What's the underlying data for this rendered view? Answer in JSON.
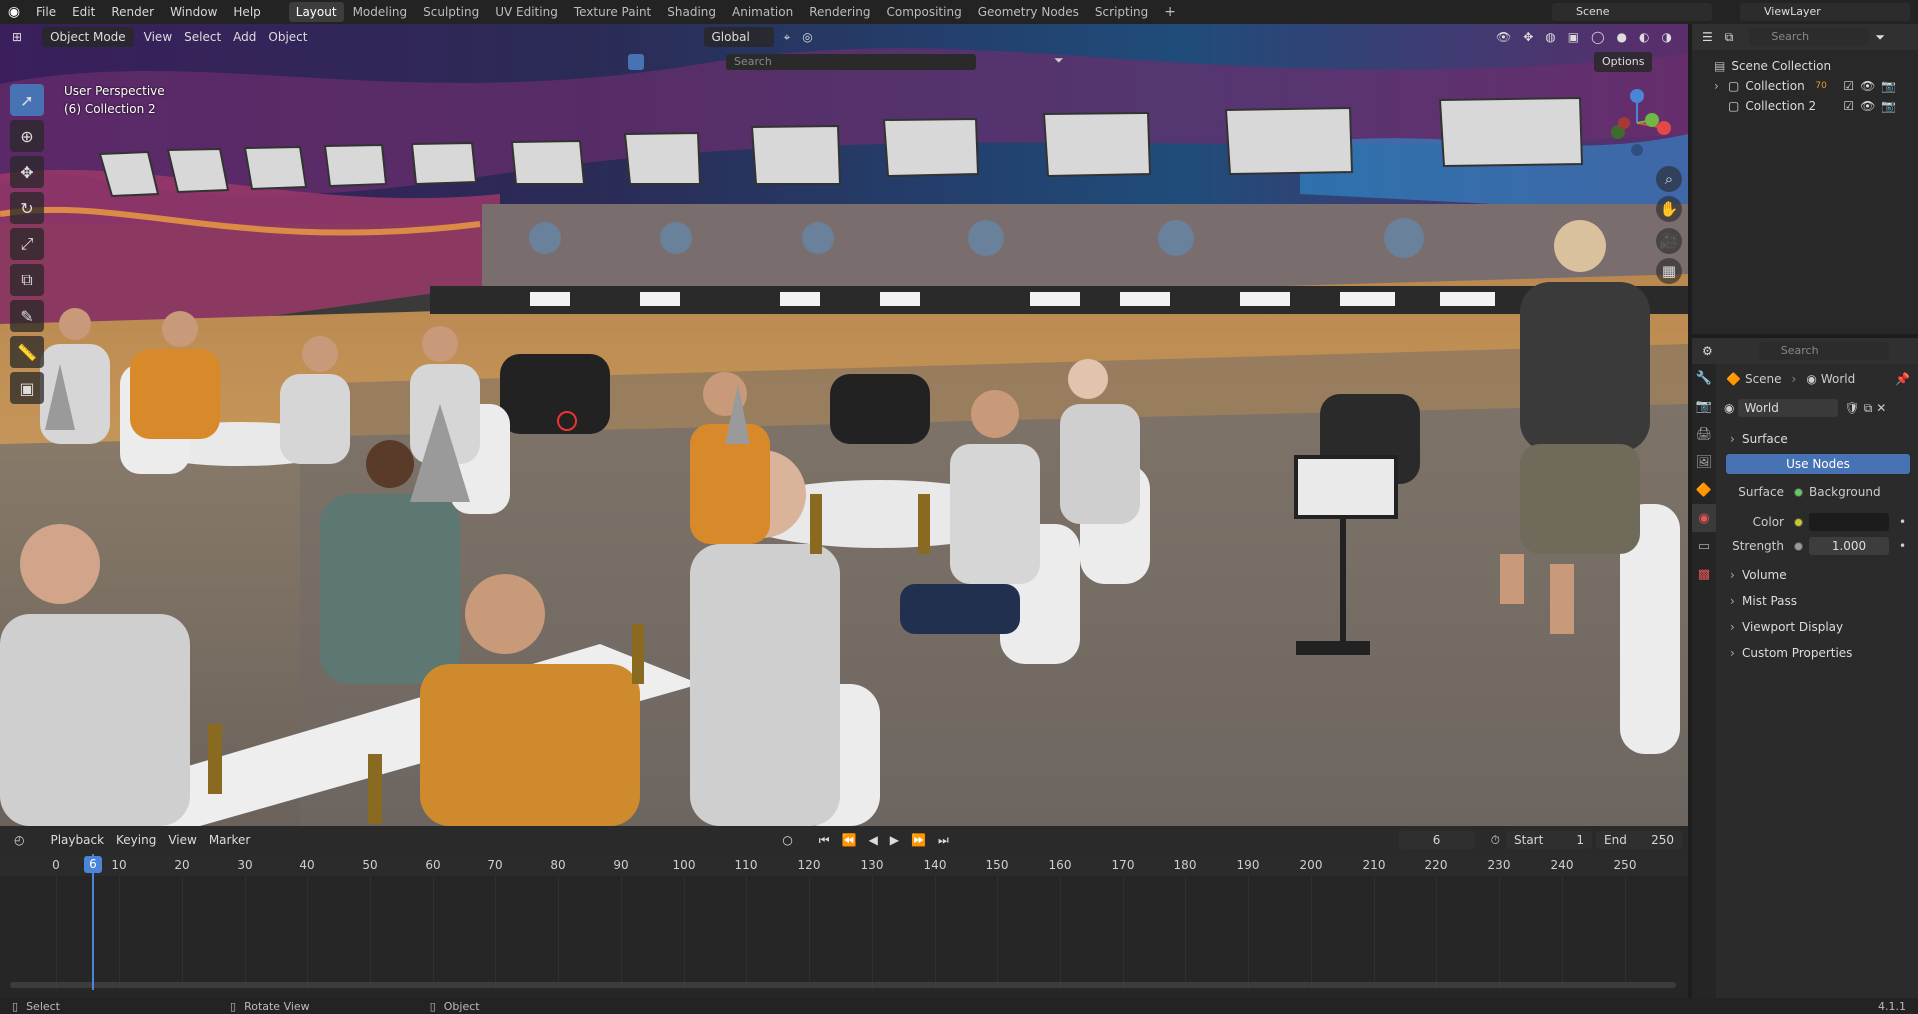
{
  "topbar": {
    "menus": [
      "File",
      "Edit",
      "Render",
      "Window",
      "Help"
    ],
    "workspaces": [
      "Layout",
      "Modeling",
      "Sculpting",
      "UV Editing",
      "Texture Paint",
      "Shading",
      "Animation",
      "Rendering",
      "Compositing",
      "Geometry Nodes",
      "Scripting"
    ],
    "active_workspace": "Layout",
    "scene": "Scene",
    "view_layer": "ViewLayer"
  },
  "viewport": {
    "mode": "Object Mode",
    "menus": [
      "View",
      "Select",
      "Add",
      "Object"
    ],
    "transform_orientation": "Global",
    "search_placeholder": "Search",
    "options_label": "Options",
    "perspective_label": "User Perspective",
    "collection_label": "(6) Collection 2"
  },
  "outliner": {
    "search_placeholder": "Search",
    "root": "Scene Collection",
    "items": [
      {
        "name": "Collection",
        "badge": "70"
      },
      {
        "name": "Collection 2",
        "badge": ""
      }
    ]
  },
  "properties": {
    "search_placeholder": "Search",
    "breadcrumb_scene": "Scene",
    "breadcrumb_world": "World",
    "world_name": "World",
    "surface_section": "Surface",
    "use_nodes_label": "Use Nodes",
    "surface_label": "Surface",
    "surface_value": "Background",
    "color_label": "Color",
    "strength_label": "Strength",
    "strength_value": "1.000",
    "sections": [
      "Volume",
      "Mist Pass",
      "Viewport Display",
      "Custom Properties"
    ]
  },
  "timeline": {
    "menus": [
      "Playback",
      "Keying",
      "View",
      "Marker"
    ],
    "current_frame": "6",
    "start_label": "Start",
    "start_value": "1",
    "end_label": "End",
    "end_value": "250",
    "ticks": [
      "0",
      "10",
      "20",
      "30",
      "40",
      "50",
      "60",
      "70",
      "80",
      "90",
      "100",
      "110",
      "120",
      "130",
      "140",
      "150",
      "160",
      "170",
      "180",
      "190",
      "200",
      "210",
      "220",
      "230",
      "240",
      "250"
    ]
  },
  "statusbar": {
    "select": "Select",
    "rotate": "Rotate View",
    "object": "Object",
    "version": "4.1.1"
  }
}
